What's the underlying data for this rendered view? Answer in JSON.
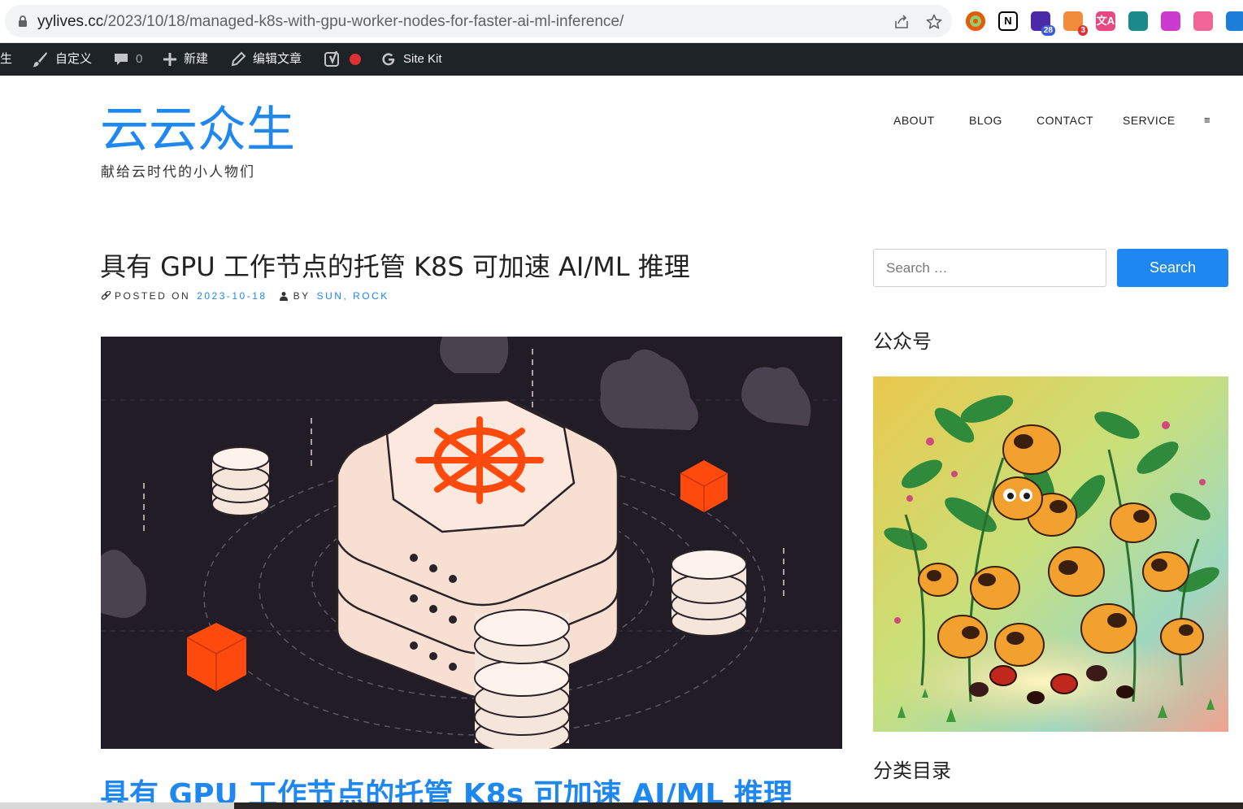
{
  "browser": {
    "url_host": "yylives.cc",
    "url_path": "/2023/10/18/managed-k8s-with-gpu-worker-nodes-for-faster-ai-ml-inference/",
    "extensions": [
      {
        "name": "chrome-ext-icon",
        "color": "#e8590c",
        "label": ""
      },
      {
        "name": "notion-icon",
        "color": "#000000",
        "label": "N"
      },
      {
        "name": "graduation-cap-icon",
        "color": "#4b2aa8",
        "label": "",
        "badge": "28"
      },
      {
        "name": "cloud-ext-icon",
        "color": "#f08c3c",
        "label": "",
        "badge": "3"
      },
      {
        "name": "translate-icon",
        "color": "#e64980",
        "label": "文A"
      },
      {
        "name": "grid-ext-icon",
        "color": "#1c8a8a",
        "label": ""
      },
      {
        "name": "purple-ext-icon",
        "color": "#cc3bcf",
        "label": ""
      },
      {
        "name": "weibo-ext-icon",
        "color": "#f06595",
        "label": ""
      },
      {
        "name": "blue-ext-icon",
        "color": "#1c7ed6",
        "label": ""
      }
    ]
  },
  "adminbar": {
    "site_fragment": "生",
    "customize": "自定义",
    "comments_count": "0",
    "new": "新建",
    "edit_post": "编辑文章",
    "site_kit": "Site Kit"
  },
  "site": {
    "title": "云云众生",
    "tagline": "献给云时代的小人物们"
  },
  "nav": {
    "items": [
      "ABOUT",
      "BLOG",
      "CONTACT",
      "SERVICE"
    ],
    "menu_glyph": "≡"
  },
  "post": {
    "title": "具有 GPU 工作节点的托管 K8S 可加速 AI/ML 推理",
    "posted_on_label": "POSTED ON",
    "date": "2023-10-18",
    "by_label": "BY",
    "authors": "SUN, ROCK",
    "link_title": "具有 GPU 工作节点的托管 K8s 可加速 AI/ML 推理"
  },
  "sidebar": {
    "search_placeholder": "Search …",
    "search_button": "Search",
    "widget1_title": "公众号",
    "widget2_title": "分类目录"
  },
  "colors": {
    "accent": "#1e87f0",
    "adminbar": "#1d2327",
    "hero_bg": "#221c27",
    "k8s_orange": "#ff4a0e"
  }
}
